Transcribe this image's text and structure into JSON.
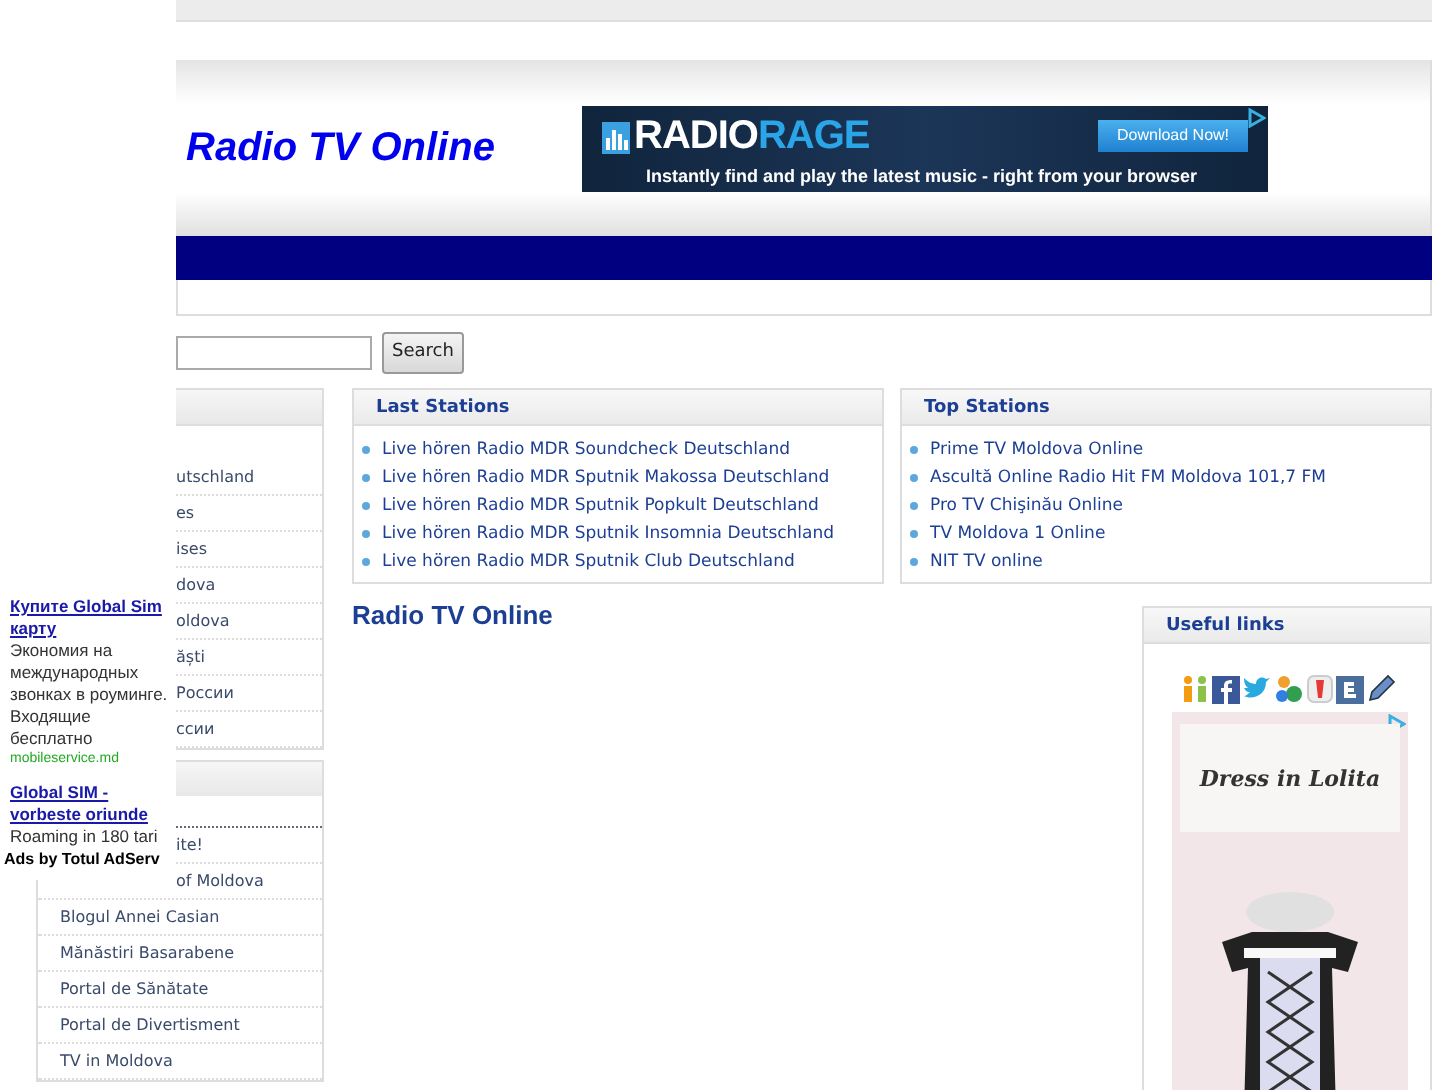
{
  "header": {
    "site_title": "Radio TV Online",
    "banner_ad": {
      "brand_left": "RADIO",
      "brand_right": "RAGE",
      "button": "Download Now!",
      "tagline": "Instantly find and play the latest music - right from your browser"
    }
  },
  "search": {
    "button": "Search"
  },
  "left_boxes": [
    {
      "items": [
        {
          "text": "utschland",
          "kind": "full"
        },
        {
          "text": "es",
          "kind": "full"
        },
        {
          "text": "ises",
          "kind": "full"
        },
        {
          "text": "dova",
          "kind": "full"
        },
        {
          "text": "oldova",
          "kind": "full"
        },
        {
          "text": "ăști",
          "kind": "full"
        },
        {
          "text": "России",
          "kind": "full"
        },
        {
          "text": "ссии",
          "kind": "full"
        }
      ]
    },
    {
      "items": [
        {
          "text": "ite!",
          "kind": "partial"
        },
        {
          "text": "of Moldova",
          "kind": "partial"
        },
        {
          "text": "Blogul Annei Casian",
          "kind": "full"
        },
        {
          "text": "Mănăstiri Basarabene",
          "kind": "full"
        },
        {
          "text": "Portal de Sănătate",
          "kind": "full"
        },
        {
          "text": "Portal de Divertisment",
          "kind": "full"
        },
        {
          "text": "TV in Moldova",
          "kind": "full"
        }
      ]
    }
  ],
  "last_stations": {
    "title": "Last Stations",
    "items": [
      "Live hören Radio MDR Soundcheck Deutschland",
      "Live hören Radio MDR Sputnik Makossa Deutschland",
      "Live hören Radio MDR Sputnik Popkult Deutschland",
      "Live hören Radio MDR Sputnik Insomnia Deutschland",
      "Live hören Radio MDR Sputnik Club Deutschland"
    ]
  },
  "top_stations": {
    "title": "Top Stations",
    "items": [
      "Prime TV Moldova Online",
      "Ascultă Online Radio Hit FM Moldova 101,7 FM",
      "Pro TV Chişinău Online",
      "TV Moldova 1 Online",
      "NIT TV online"
    ]
  },
  "main_heading": "Radio TV Online",
  "useful_links": {
    "title": "Useful links",
    "ad_caption": "Dress in Lolita"
  },
  "overlay_ad": {
    "ads": [
      {
        "title": "Купите Global Sim карту",
        "text": "Экономия на международных звонках в роуминге. Входящие бесплатно",
        "url": "mobileservice.md"
      },
      {
        "title": "Global SIM - vorbeste oriunde",
        "text": "Roaming in 180 tari"
      }
    ],
    "footer": "Ads by Totul AdServ"
  }
}
